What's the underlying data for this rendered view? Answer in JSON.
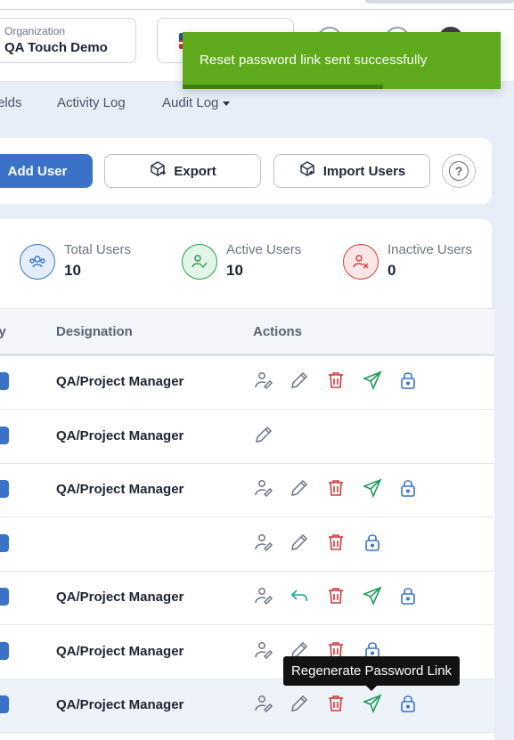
{
  "header": {
    "organization_label": "Organization",
    "organization_value": "QA Touch Demo"
  },
  "toast": {
    "message": "Reset password link sent successfully",
    "progress_percent": 63
  },
  "tabs": [
    {
      "label": "elds"
    },
    {
      "label": "Activity Log"
    },
    {
      "label": "Audit Log"
    }
  ],
  "toolbar": {
    "add_user_label": "Add User",
    "export_label": "Export",
    "import_label": "Import Users",
    "help_label": "?"
  },
  "stats": [
    {
      "label": "Total Users",
      "value": "10",
      "color": "#3a72c8"
    },
    {
      "label": "Active Users",
      "value": "10",
      "color": "#2e9a4e"
    },
    {
      "label": "Inactive Users",
      "value": "0",
      "color": "#d23b3b"
    }
  ],
  "table": {
    "columns": [
      "ey",
      "Designation",
      "Actions"
    ],
    "rows": [
      {
        "designation": "QA/Project Manager",
        "actions": [
          "assign-user",
          "edit",
          "delete",
          "send-reset-link",
          "lock"
        ]
      },
      {
        "designation": "QA/Project Manager",
        "actions": [
          "edit"
        ]
      },
      {
        "designation": "QA/Project Manager",
        "actions": [
          "assign-user",
          "edit",
          "delete",
          "send-reset-link",
          "lock"
        ]
      },
      {
        "designation": "",
        "actions": [
          "assign-user",
          "edit",
          "delete",
          "lock"
        ]
      },
      {
        "designation": "QA/Project Manager",
        "actions": [
          "assign-user",
          "restore",
          "delete",
          "send-reset-link",
          "lock"
        ]
      },
      {
        "designation": "QA/Project Manager",
        "actions": [
          "assign-user",
          "edit",
          "delete",
          "lock"
        ]
      },
      {
        "designation": "QA/Project Manager",
        "actions": [
          "assign-user",
          "edit",
          "delete",
          "send-reset-link",
          "lock"
        ]
      }
    ]
  },
  "tooltip": {
    "text": "Regenerate Password Link"
  },
  "colors": {
    "primary": "#3a72c8",
    "success_toast": "#5fa91d",
    "danger": "#d23b3b",
    "send": "#1f9a5a",
    "restore": "#1aa3a0"
  }
}
